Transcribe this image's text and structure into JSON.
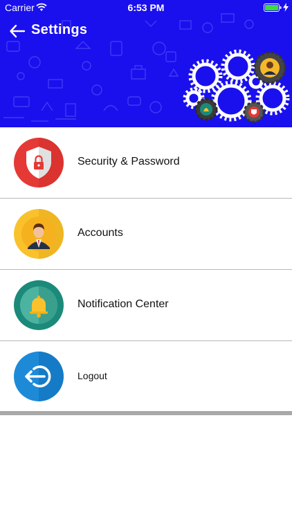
{
  "status_bar": {
    "carrier": "Carrier",
    "time": "6:53 PM",
    "battery_icon": "battery-full-icon",
    "wifi_icon": "wifi-icon"
  },
  "nav": {
    "title": "Settings",
    "back_icon": "back-arrow-icon"
  },
  "colors": {
    "header_bg": "#1a10ee",
    "security": "#e53935",
    "accounts": "#f9c22c",
    "notifications": "#1b8a7a",
    "logout": "#1d8ad8"
  },
  "menu": {
    "items": [
      {
        "label": "Security & Password",
        "icon": "shield-lock-icon"
      },
      {
        "label": "Accounts",
        "icon": "user-avatar-icon"
      },
      {
        "label": "Notification Center",
        "icon": "bell-icon"
      },
      {
        "label": "Logout",
        "icon": "logout-icon"
      }
    ]
  }
}
